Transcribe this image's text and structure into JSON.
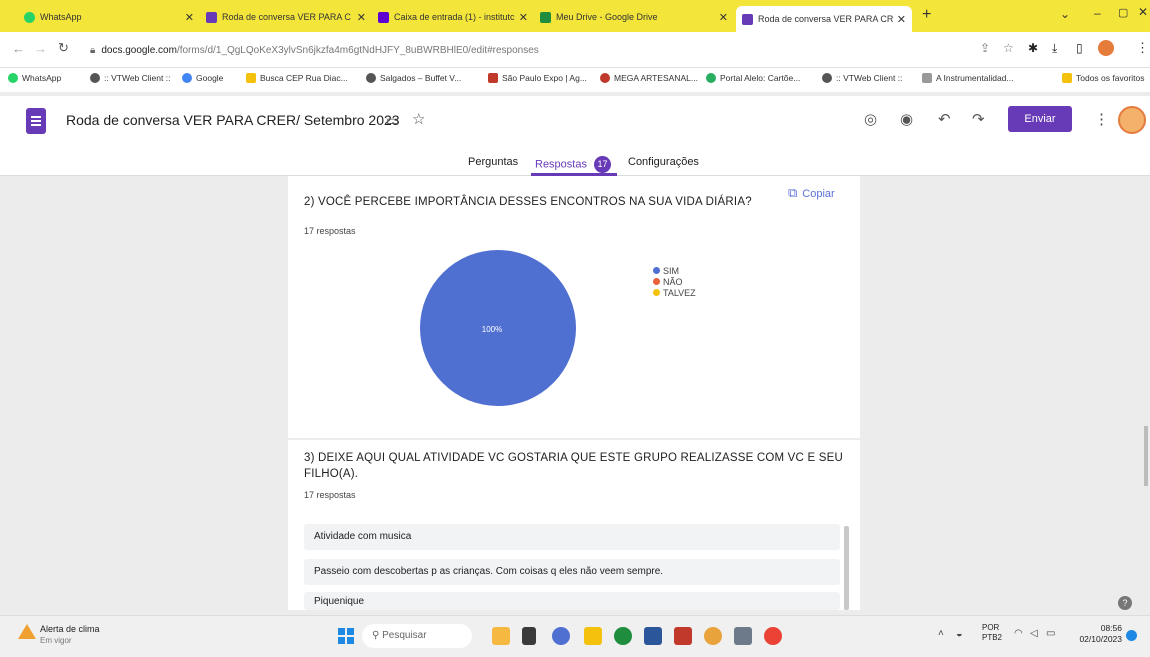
{
  "browser": {
    "tabs": [
      {
        "label": "WhatsApp",
        "color": "#25d366"
      },
      {
        "label": "Roda de conversa VER PARA C",
        "color": "#673ab7"
      },
      {
        "label": "Caixa de entrada (1) - institutc",
        "color": "#6001d2"
      },
      {
        "label": "Meu Drive - Google Drive",
        "color": "#1e8e3e"
      },
      {
        "label": "Roda de conversa VER PARA CR",
        "color": "#673ab7"
      }
    ],
    "url_host": "docs.google.com",
    "url_path": "/forms/d/1_QgLQoKeX3ylvSn6jkzfa4m6gtNdHJFY_8uBWRBHlE0/edit#responses",
    "bookmarks": [
      "WhatsApp",
      ":: VTWeb Client ::",
      "Google",
      "Busca CEP Rua Diac...",
      "Salgados – Buffet V...",
      "São Paulo Expo | Ag...",
      "MEGA ARTESANAL...",
      "Portal Alelo: Cartõe...",
      ":: VTWeb Client ::",
      "A Instrumentalidad...",
      "Todos os favoritos"
    ]
  },
  "form": {
    "title": "Roda de conversa VER PARA CRER/ Setembro 2023",
    "send_label": "Enviar",
    "nav": {
      "questions": "Perguntas",
      "responses": "Respostas",
      "responses_count": "17",
      "settings": "Configurações"
    }
  },
  "q2": {
    "title": "2) VOCÊ PERCEBE IMPORTÂNCIA DESSES ENCONTROS NA SUA VIDA DIÁRIA?",
    "count": "17 respostas",
    "copy_label": "Copiar"
  },
  "chart_data": {
    "type": "pie",
    "categories": [
      "SIM",
      "NÃO",
      "TALVEZ"
    ],
    "values": [
      100,
      0,
      0
    ],
    "colors": [
      "#4f6fd1",
      "#e8603c",
      "#f4c20d"
    ],
    "slice_label": "100%"
  },
  "q3": {
    "title_line1": "3) DEIXE AQUI QUAL ATIVIDADE VC GOSTARIA QUE ESTE GRUPO REALIZASSE COM VC E SEU",
    "title_line2": "FILHO(A).",
    "count": "17 respostas",
    "answers": [
      "Atividade com musica",
      "Passeio com descobertas p as crianças. Com coisas q eles não veem sempre.",
      "Piquenique"
    ]
  },
  "taskbar": {
    "weather_title": "Alerta de clima",
    "weather_sub": "Em vigor",
    "search_placeholder": "Pesquisar",
    "lang_line1": "POR",
    "lang_line2": "PTB2",
    "time": "08:56",
    "date": "02/10/2023"
  }
}
